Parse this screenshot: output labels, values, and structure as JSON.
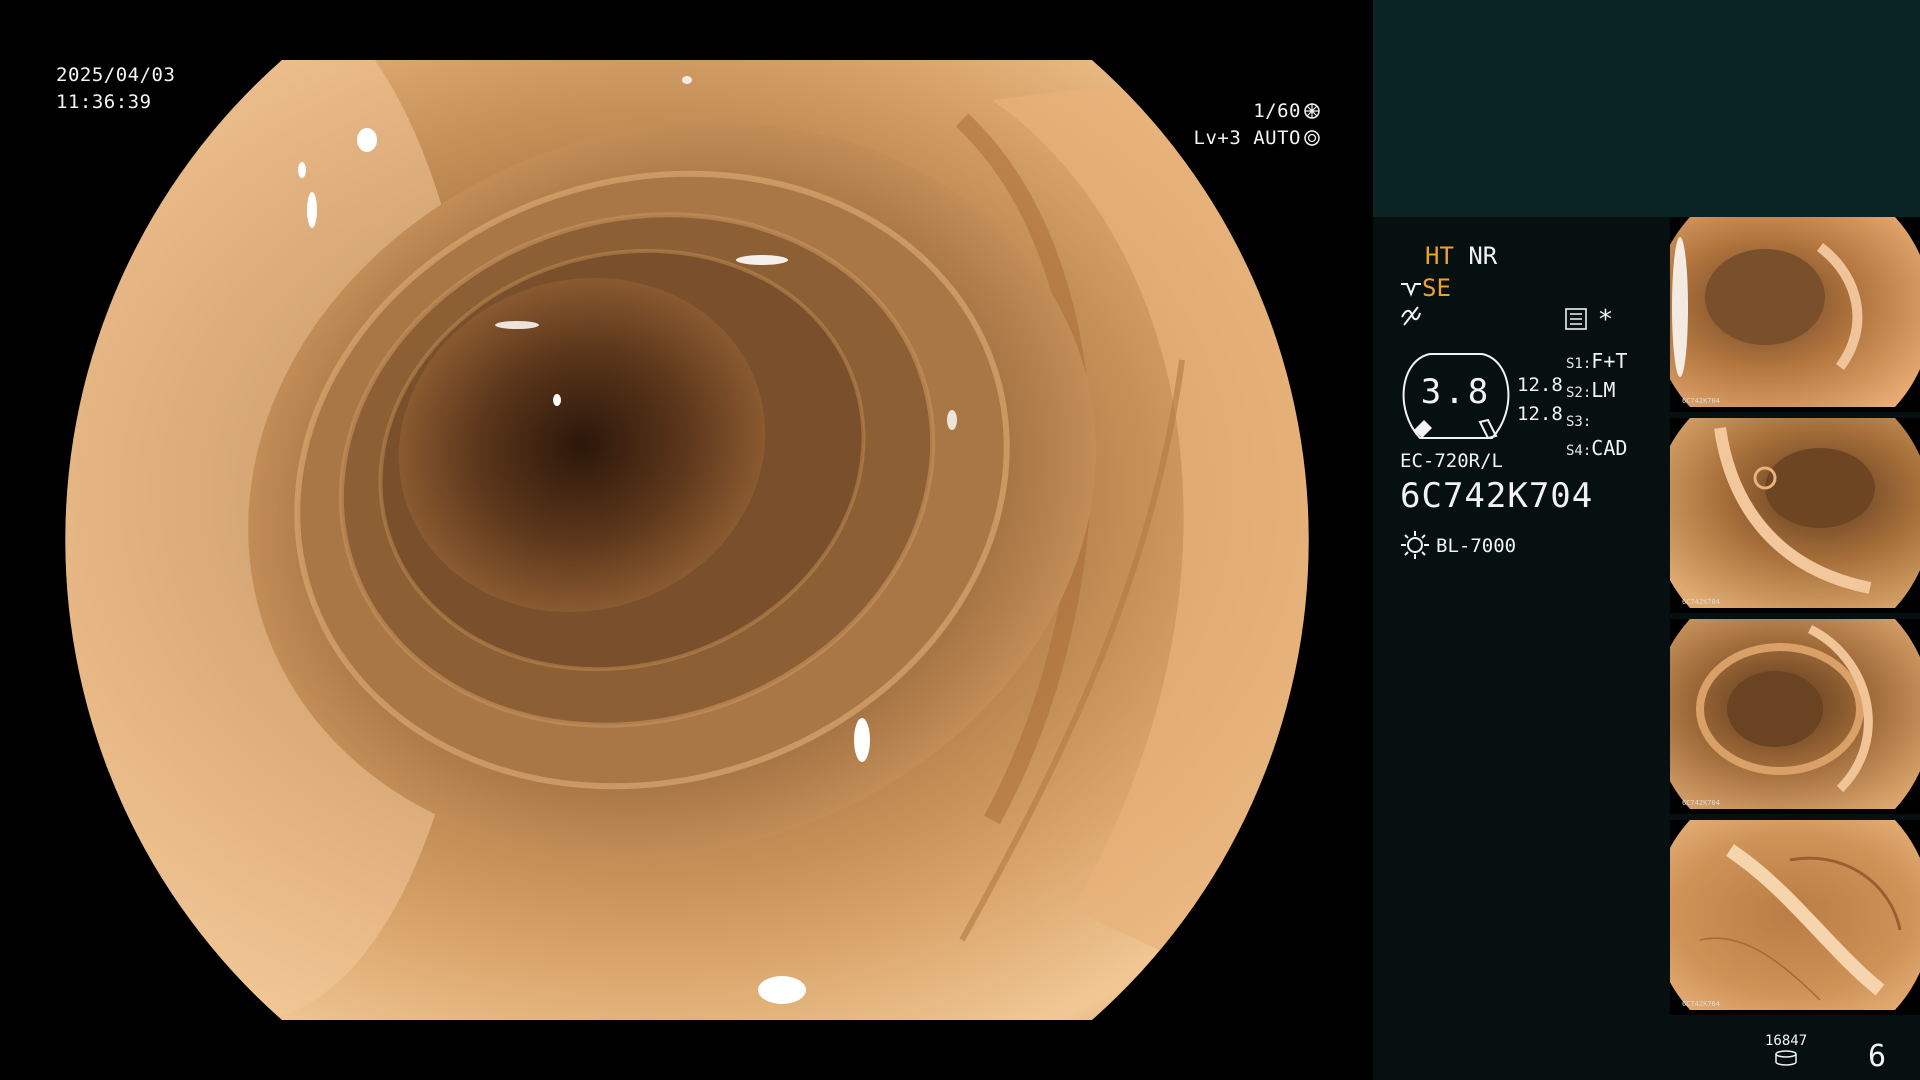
{
  "overlay": {
    "date": "2025/04/03",
    "time": "11:36:39",
    "shutter": "1/60",
    "level": "Lv+3",
    "exposure_mode": "AUTO"
  },
  "status": {
    "mode_ht": "HT",
    "mode_nr": "NR",
    "mode_se": "SE",
    "ratio_value": "3.8",
    "scale_top": "12.8",
    "scale_bottom": "12.8",
    "switches": [
      {
        "key": "S1:",
        "value": "F+T"
      },
      {
        "key": "S2:",
        "value": "LM"
      },
      {
        "key": "S3:",
        "value": ""
      },
      {
        "key": "S4:",
        "value": "CAD"
      }
    ],
    "asterisk": "*",
    "scope_model": "EC-720R/L",
    "scope_serial": "6C742K704",
    "light_source": "BL-7000"
  },
  "thumbnails": [
    {
      "caption": "6C742K704"
    },
    {
      "caption": "6C742K704"
    },
    {
      "caption": "6C742K704"
    },
    {
      "caption": "6C742K704"
    }
  ],
  "footer": {
    "record_count": "16847",
    "image_count": "6"
  },
  "colors": {
    "panel_bg": "#071011",
    "panel_top": "#0a2325",
    "accent_orange": "#f0a030",
    "mucosa_light": "#e9b57c",
    "mucosa_dark": "#3a2212"
  }
}
